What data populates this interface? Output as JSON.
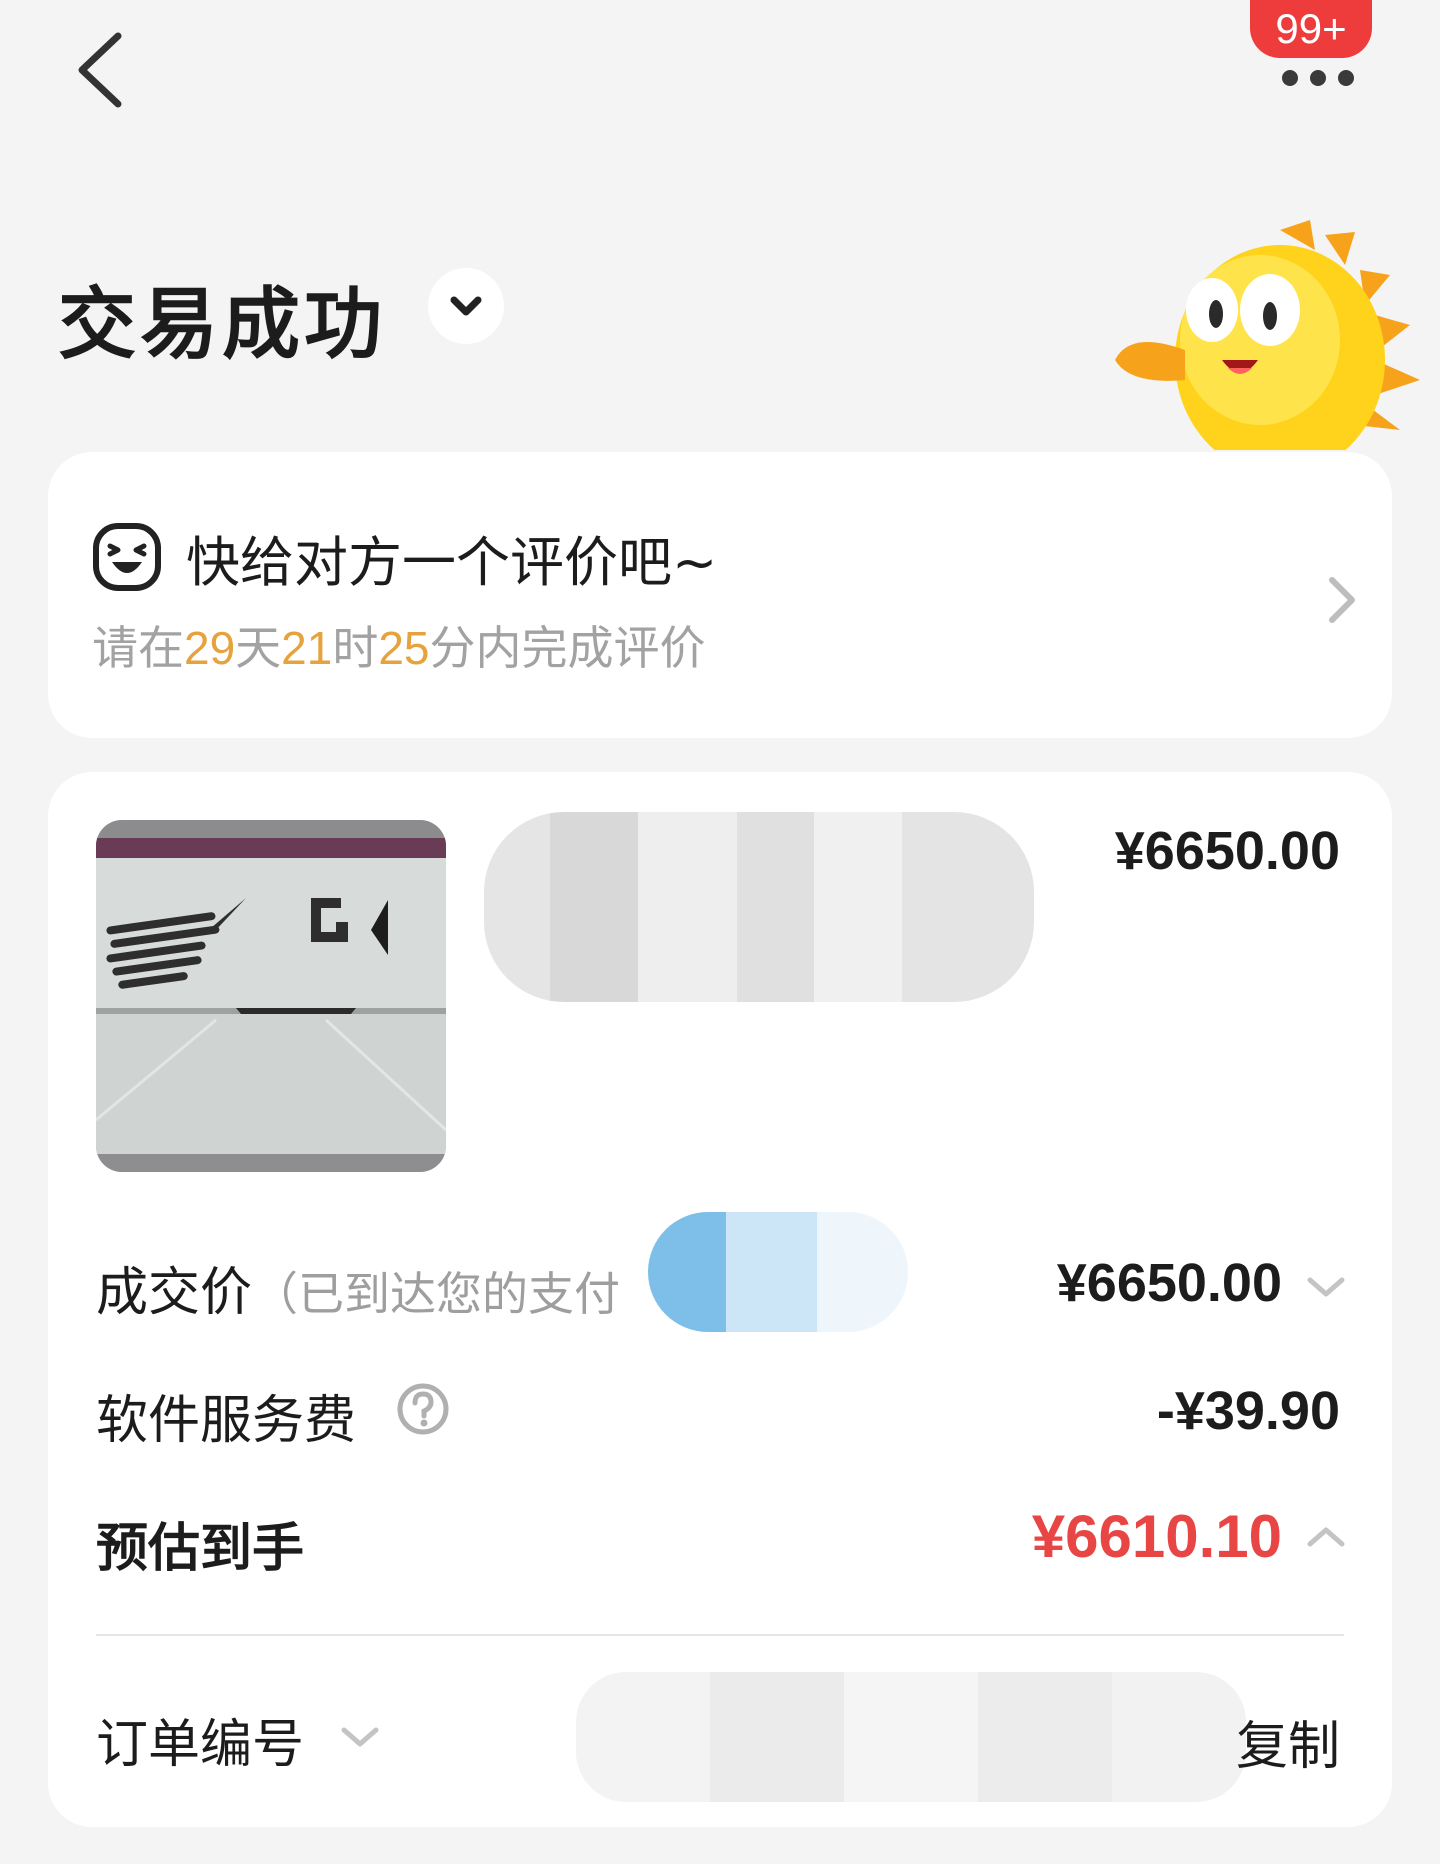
{
  "header": {
    "badge_count": "99+"
  },
  "status": {
    "title": "交易成功"
  },
  "review": {
    "title": "快给对方一个评价吧~",
    "subtitle_prefix": "请在",
    "days": "29",
    "days_unit": "天",
    "hours": "21",
    "hours_unit": "时",
    "minutes": "25",
    "minutes_unit": "分内完成评价"
  },
  "product": {
    "price": "¥6650.00"
  },
  "summary": {
    "deal_price_label": "成交价",
    "deal_price_note": "（已到达您的支付",
    "deal_price_value": "¥6650.00",
    "service_fee_label": "软件服务费",
    "service_fee_value": "-¥39.90",
    "estimated_label": "预估到手",
    "estimated_value": "¥6610.10"
  },
  "order": {
    "order_no_label": "订单编号",
    "copy_label": "复制"
  },
  "colors": {
    "accent_red": "#ee3b3b",
    "countdown_orange": "#e6a23c",
    "estimated_red": "#e84545"
  }
}
